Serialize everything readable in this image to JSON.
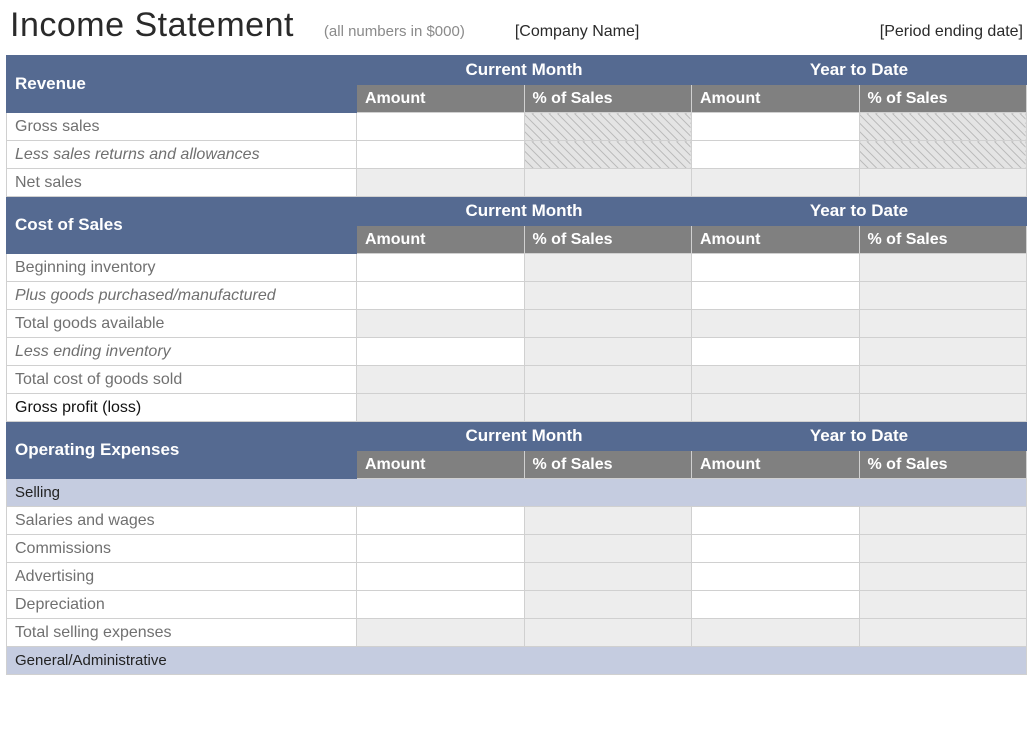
{
  "header": {
    "title": "Income Statement",
    "subtitle": "(all numbers in $000)",
    "company": "[Company Name]",
    "period": "[Period ending date]"
  },
  "col_headers": {
    "current_month": "Current Month",
    "year_to_date": "Year to Date",
    "amount": "Amount",
    "pct_sales": "% of Sales"
  },
  "sections": {
    "revenue": {
      "title": "Revenue",
      "rows": [
        {
          "label": "Gross sales"
        },
        {
          "label": "Less sales returns and allowances"
        },
        {
          "label": "Net sales"
        }
      ]
    },
    "cost_of_sales": {
      "title": "Cost of Sales",
      "rows": [
        {
          "label": "Beginning inventory"
        },
        {
          "label": "Plus goods purchased/manufactured"
        },
        {
          "label": "Total goods available"
        },
        {
          "label": "Less ending inventory"
        },
        {
          "label": "Total cost of goods sold"
        },
        {
          "label": "Gross profit (loss)"
        }
      ]
    },
    "operating_expenses": {
      "title": "Operating Expenses",
      "categories": {
        "selling": {
          "title": "Selling",
          "rows": [
            {
              "label": "Salaries and wages"
            },
            {
              "label": "Commissions"
            },
            {
              "label": "Advertising"
            },
            {
              "label": "Depreciation"
            },
            {
              "label": "Total selling expenses"
            }
          ]
        },
        "general_admin": {
          "title": "General/Administrative"
        }
      }
    }
  }
}
